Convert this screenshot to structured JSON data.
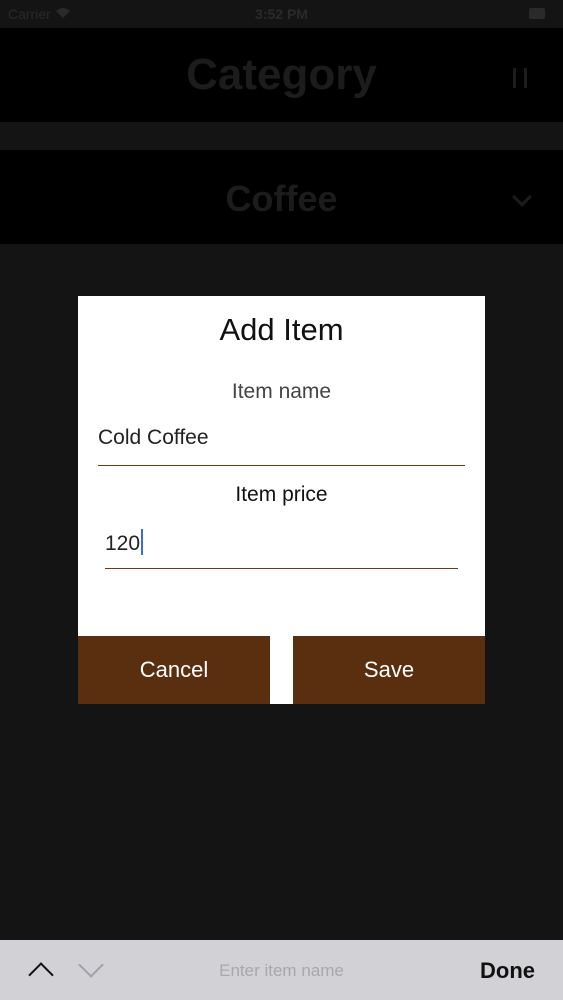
{
  "status_bar": {
    "carrier": "Carrier",
    "time": "3:52 PM"
  },
  "header": {
    "title": "Category"
  },
  "category_row": {
    "label": "Coffee"
  },
  "dialog": {
    "title": "Add Item",
    "name_label": "Item name",
    "name_value": "Cold Coffee",
    "price_label": "Item price",
    "price_value": "120",
    "cancel_label": "Cancel",
    "save_label": "Save"
  },
  "keyboard_toolbar": {
    "hint": "Enter item name",
    "done_label": "Done"
  },
  "colors": {
    "button_brown": "#5a2f10",
    "underline": "#6b3a17",
    "caret": "#2f6fe0"
  }
}
